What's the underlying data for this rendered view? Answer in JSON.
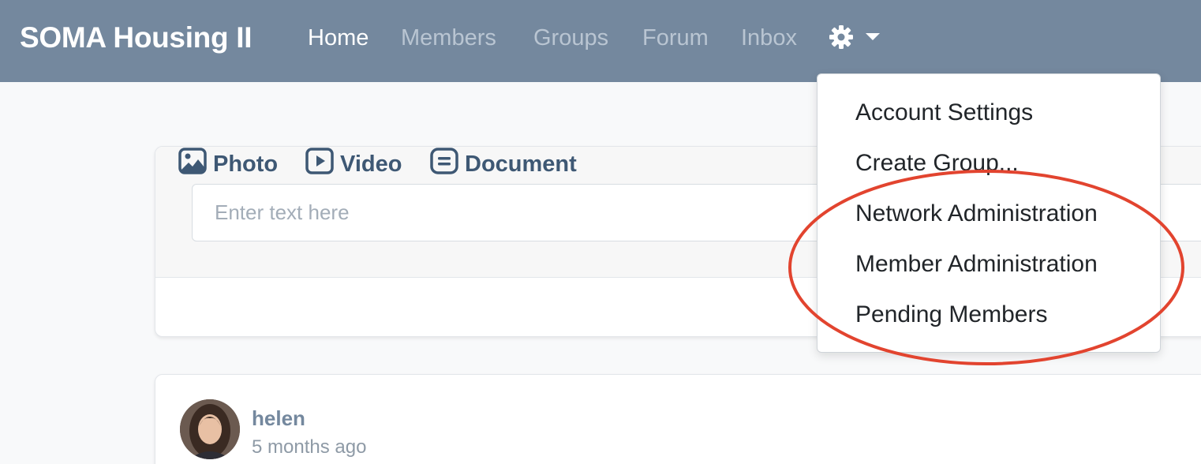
{
  "navbar": {
    "brand": "SOMA Housing II",
    "links": [
      {
        "label": "Home",
        "active": true
      },
      {
        "label": "Members",
        "active": false
      },
      {
        "label": "Groups",
        "active": false
      },
      {
        "label": "Forum",
        "active": false
      },
      {
        "label": "Inbox",
        "active": false
      }
    ],
    "settings_icon": "gear-icon",
    "caret_icon": "caret-down-icon"
  },
  "dropdown": {
    "items": [
      {
        "label": "Account Settings"
      },
      {
        "label": "Create Group..."
      },
      {
        "label": "Network Administration"
      },
      {
        "label": "Member Administration"
      },
      {
        "label": "Pending Members"
      }
    ]
  },
  "composer": {
    "placeholder": "Enter text here",
    "attachments": [
      {
        "label": "Photo",
        "icon": "photo-icon"
      },
      {
        "label": "Video",
        "icon": "video-icon"
      },
      {
        "label": "Document",
        "icon": "document-icon"
      }
    ]
  },
  "post": {
    "author": "helen",
    "time": "5 months ago"
  },
  "colors": {
    "navbar": "#74889e",
    "accent": "#3e5874",
    "highlight": "#e2442f"
  }
}
